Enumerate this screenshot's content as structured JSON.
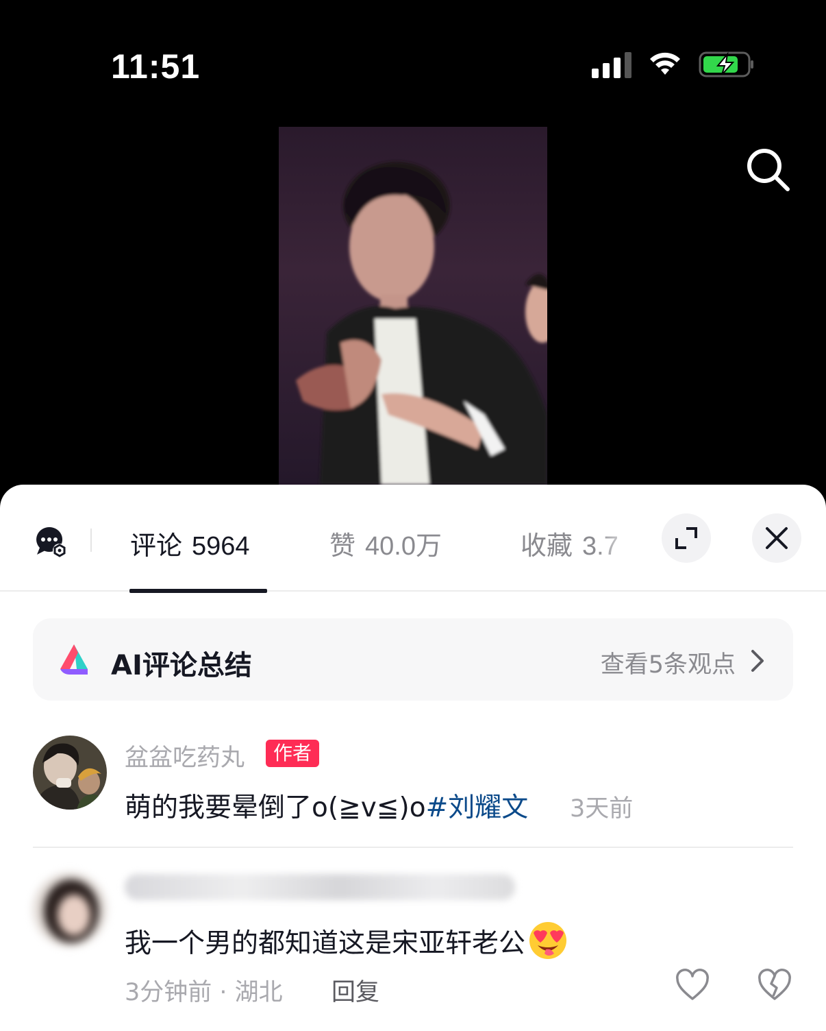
{
  "status_bar": {
    "time": "11:51"
  },
  "tabs": [
    {
      "label": "评论",
      "count": "5964"
    },
    {
      "label": "赞",
      "count": "40.0万"
    },
    {
      "label": "收藏",
      "count": "3.7"
    }
  ],
  "ai_summary": {
    "title": "AI评论总结",
    "link": "查看5条观点"
  },
  "comments": [
    {
      "username": "盆盆吃药丸",
      "badge": "作者",
      "text": "萌的我要晕倒了o(≧v≦)o",
      "hashtag": "#刘耀文",
      "time": "3天前"
    },
    {
      "text": "我一个男的都知道这是宋亚轩老公",
      "time_location": "3分钟前 · 湖北",
      "reply_label": "回复"
    }
  ],
  "colors": {
    "accent_pink": "#fe2c55",
    "hashtag_blue": "#0b4a8a",
    "text_primary": "#161823",
    "text_secondary": "#a9a9ae"
  }
}
